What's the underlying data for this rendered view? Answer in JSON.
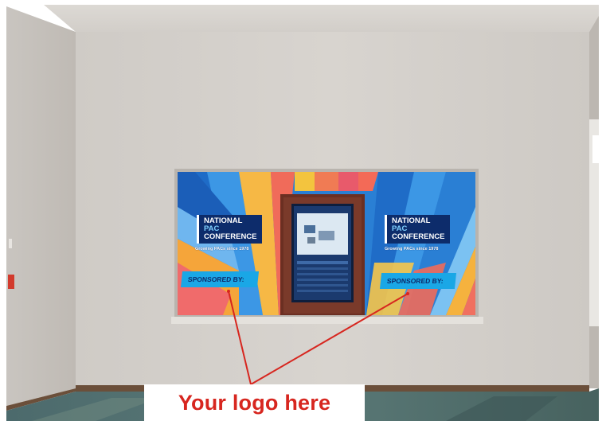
{
  "banner_left": {
    "title_line1": "NATIONAL",
    "title_line2": "PAC",
    "title_line3": "CONFERENCE",
    "tagline": "Growing PACs since 1978",
    "sponsor_label": "SPONSORED BY:"
  },
  "banner_right": {
    "title_line1": "NATIONAL",
    "title_line2": "PAC",
    "title_line3": "CONFERENCE",
    "tagline": "Growing PACs since 1978",
    "sponsor_label": "SPONSORED BY:"
  },
  "callout": {
    "text": "Your logo here",
    "color": "#d7261f"
  }
}
